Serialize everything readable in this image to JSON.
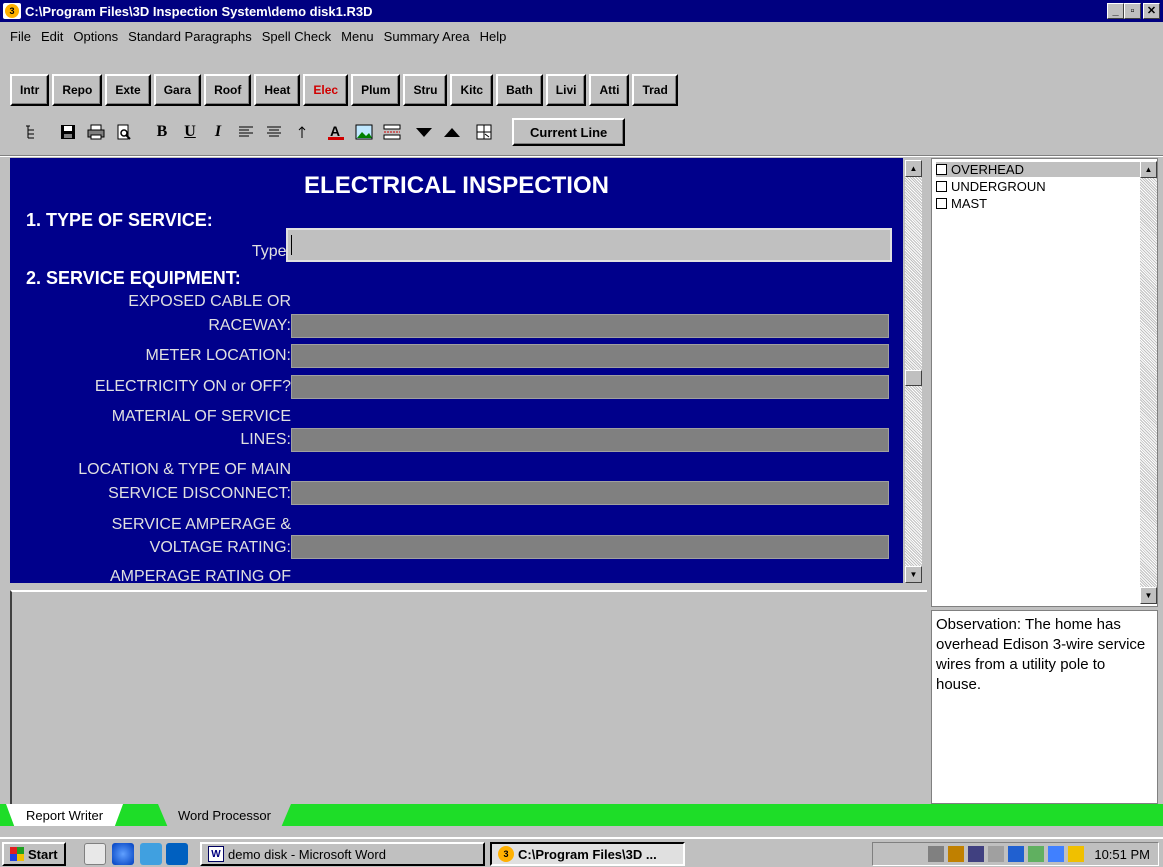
{
  "window": {
    "title": "C:\\Program Files\\3D Inspection System\\demo disk1.R3D",
    "min_label": "_",
    "max_label": "▫",
    "close_label": "✕"
  },
  "menu": [
    "File",
    "Edit",
    "Options",
    "Standard Paragraphs",
    "Spell Check",
    "Menu",
    "Summary Area",
    "Help"
  ],
  "section_buttons": [
    "Intr",
    "Repo",
    "Exte",
    "Gara",
    "Roof",
    "Heat",
    "Elec",
    "Plum",
    "Stru",
    "Kitc",
    "Bath",
    "Livi",
    "Atti",
    "Trad"
  ],
  "active_section": "Elec",
  "toolbar": {
    "current_line_label": "Current Line",
    "icons": [
      "outline-icon",
      "save-icon",
      "print-icon",
      "print-preview-icon",
      "bold-icon",
      "underline-icon",
      "italic-icon",
      "align-left-icon",
      "center-icon",
      "arrow-icon",
      "font-color-icon",
      "picture-icon",
      "page-break-icon",
      "move-down-icon",
      "move-up-icon",
      "table-icon"
    ]
  },
  "form": {
    "title": "ELECTRICAL INSPECTION",
    "section1": "1. TYPE OF SERVICE:",
    "type_label": "Type:",
    "section2": "2. SERVICE EQUIPMENT:",
    "fields": [
      {
        "label": "EXPOSED CABLE OR RACEWAY:",
        "l1": "EXPOSED CABLE OR",
        "l2": "RACEWAY:"
      },
      {
        "label": "METER LOCATION:",
        "l1": "",
        "l2": "METER LOCATION:"
      },
      {
        "label": "ELECTRICITY ON or OFF?",
        "l1": "",
        "l2": "ELECTRICITY ON or OFF?"
      },
      {
        "label": "MATERIAL OF SERVICE LINES:",
        "l1": "MATERIAL OF SERVICE",
        "l2": "LINES:"
      },
      {
        "label": "LOCATION & TYPE OF MAIN SERVICE DISCONNECT:",
        "l1": "LOCATION & TYPE OF MAIN",
        "l2": "SERVICE DISCONNECT:"
      },
      {
        "label": "SERVICE AMPERAGE & VOLTAGE RATING:",
        "l1": "SERVICE AMPERAGE &",
        "l2": "VOLTAGE RATING:"
      }
    ],
    "partial_label": "AMPERAGE RATING OF"
  },
  "options_list": [
    {
      "label": "OVERHEAD",
      "selected": true
    },
    {
      "label": "UNDERGROUN",
      "selected": false
    },
    {
      "label": "MAST",
      "selected": false
    }
  ],
  "observation": "Observation:  The home has overhead Edison 3-wire service wires from a utility pole to house.",
  "bottom_tabs": [
    "Report Writer",
    "Word Processor"
  ],
  "taskbar": {
    "start_label": "Start",
    "tasks": [
      "demo disk - Microsoft Word",
      "C:\\Program Files\\3D ..."
    ],
    "clock": "10:51 PM"
  }
}
